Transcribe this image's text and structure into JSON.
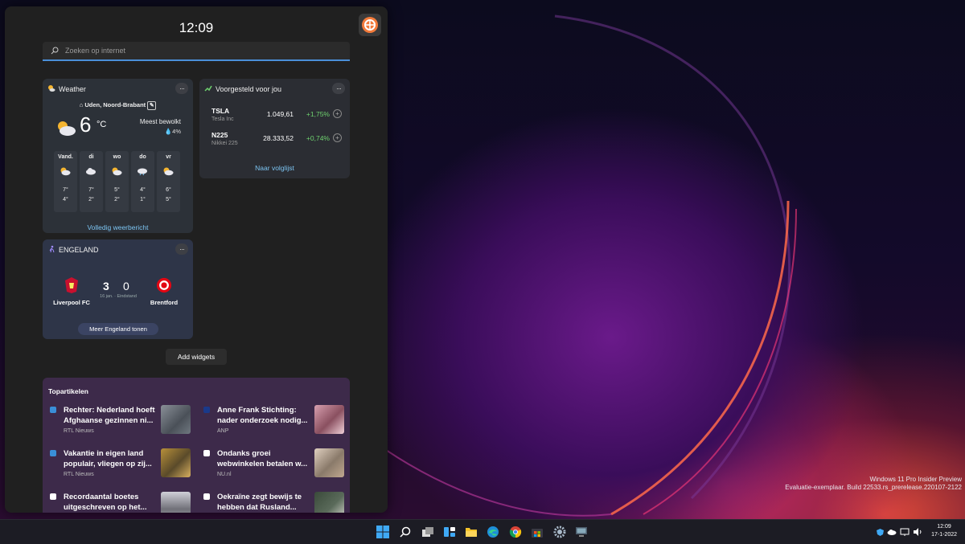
{
  "desktop": {
    "watermark_line1": "Windows 11 Pro Insider Preview",
    "watermark_line2": "Evaluatie-exemplaar. Build 22533.rs_prerelease.220107-2122"
  },
  "widgets": {
    "clock": "12:09",
    "search_placeholder": "Zoeken op internet",
    "add_widgets": "Add widgets"
  },
  "weather": {
    "title": "Weather",
    "location": "Uden, Noord-Brabant",
    "temperature": "6",
    "unit": "°C",
    "condition": "Meest bewolkt",
    "precipitation": "4%",
    "forecast": [
      {
        "day": "Vand.",
        "high": "7°",
        "low": "4°"
      },
      {
        "day": "di",
        "high": "7°",
        "low": "2°"
      },
      {
        "day": "wo",
        "high": "5°",
        "low": "2°"
      },
      {
        "day": "do",
        "high": "4°",
        "low": "1°"
      },
      {
        "day": "vr",
        "high": "6°",
        "low": "5°"
      }
    ],
    "link": "Volledig weerbericht"
  },
  "stocks": {
    "title": "Voorgesteld voor jou",
    "items": [
      {
        "symbol": "TSLA",
        "name": "Tesla Inc",
        "price": "1.049,61",
        "change": "+1,75%"
      },
      {
        "symbol": "N225",
        "name": "Nikkei 225",
        "price": "28.333,52",
        "change": "+0,74%"
      }
    ],
    "link": "Naar volglijst"
  },
  "sport": {
    "title": "ENGELAND",
    "home_team": "Liverpool FC",
    "away_team": "Brentford",
    "home_score": "3",
    "away_score": "0",
    "match_info": "16 jan. · Eindstand",
    "more": "Meer Engeland tonen"
  },
  "news": {
    "title": "Topartikelen",
    "articles": [
      {
        "headline": "Rechter: Nederland hoeft Afghaanse gezinnen ni...",
        "source": "RTL Nieuws"
      },
      {
        "headline": "Anne Frank Stichting: nader onderzoek nodig...",
        "source": "ANP"
      },
      {
        "headline": "Vakantie in eigen land populair, vliegen op zij...",
        "source": "RTL Nieuws"
      },
      {
        "headline": "Ondanks groei webwinkelen betalen w...",
        "source": "NU.nl"
      },
      {
        "headline": "Recordaantal boetes uitgeschreven op het...",
        "source": ""
      },
      {
        "headline": "Oekraïne zegt bewijs te hebben dat Rusland...",
        "source": ""
      }
    ]
  },
  "taskbar": {
    "time": "12:09",
    "date": "17-1-2022"
  },
  "colors": {
    "accent": "#4a8fd8",
    "link": "#7cc4f2",
    "positive": "#6fd36f"
  }
}
